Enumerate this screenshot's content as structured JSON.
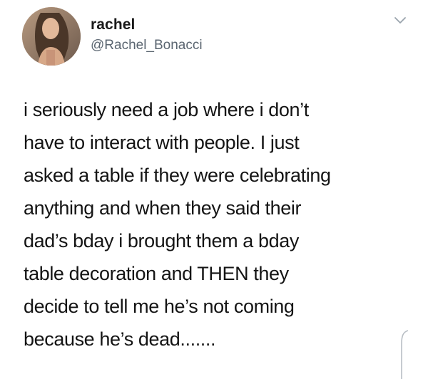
{
  "user": {
    "display_name": "rachel",
    "handle": "@Rachel_Bonacci"
  },
  "icons": {
    "menu": "chevron-down-icon",
    "avatar": "profile-photo"
  },
  "tweet": {
    "text": "i seriously need a job where i don’t\nhave to interact with people. I just\nasked a table if they were celebrating\nanything and when they said their\ndad’s bday i brought them a bday\ntable decoration and THEN they\ndecide to tell me he’s not coming\nbecause he’s dead......."
  }
}
